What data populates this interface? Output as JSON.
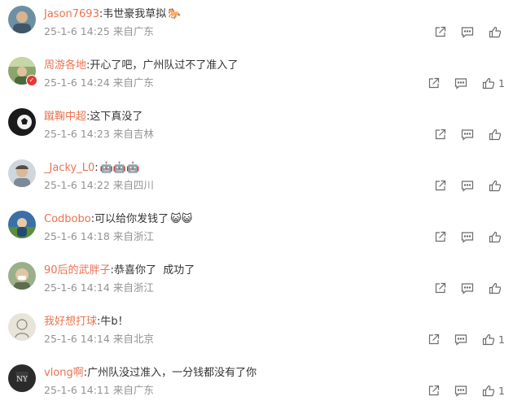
{
  "comments": [
    {
      "username": "Jason7693",
      "separator": ":",
      "text": "韦世豪我草拟",
      "emoji": "🐎",
      "time": "25-1-6 14:25",
      "location": "来自广东",
      "likes": "",
      "icons": {
        "share": "share-icon",
        "reply": "reply-icon",
        "like": "thumbs-up-icon"
      }
    },
    {
      "username": "周游各地",
      "separator": ":",
      "text": "开心了吧，广州队过不了准入了",
      "emoji": "",
      "time": "25-1-6 14:24",
      "location": "来自广东",
      "likes": "1",
      "icons": {
        "share": "share-icon",
        "reply": "reply-icon",
        "like": "thumbs-up-icon"
      }
    },
    {
      "username": "蹴鞠中超",
      "separator": ":",
      "text": "这下真没了",
      "emoji": "",
      "time": "25-1-6 14:23",
      "location": "来自吉林",
      "likes": "",
      "icons": {
        "share": "share-icon",
        "reply": "reply-icon",
        "like": "thumbs-up-icon"
      }
    },
    {
      "username": "_Jacky_L0",
      "separator": ":",
      "text": "",
      "emoji": "🤖🤖🤖",
      "time": "25-1-6 14:22",
      "location": "来自四川",
      "likes": "",
      "icons": {
        "share": "share-icon",
        "reply": "reply-icon",
        "like": "thumbs-up-icon"
      }
    },
    {
      "username": "Codbobo",
      "separator": ":",
      "text": "可以给你发钱了",
      "emoji": "😺😺",
      "time": "25-1-6 14:18",
      "location": "来自浙江",
      "likes": "",
      "icons": {
        "share": "share-icon",
        "reply": "reply-icon",
        "like": "thumbs-up-icon"
      }
    },
    {
      "username": "90后的武胖子",
      "separator": ":",
      "text": "恭喜你了  成功了",
      "emoji": "",
      "time": "25-1-6 14:14",
      "location": "来自浙江",
      "likes": "",
      "icons": {
        "share": "share-icon",
        "reply": "reply-icon",
        "like": "thumbs-up-icon"
      }
    },
    {
      "username": "我好想打球",
      "separator": ":",
      "text": "牛b！",
      "emoji": "",
      "time": "25-1-6 14:14",
      "location": "来自北京",
      "likes": "1",
      "icons": {
        "share": "share-icon",
        "reply": "reply-icon",
        "like": "thumbs-up-icon"
      }
    },
    {
      "username": "vlong啊",
      "separator": ":",
      "text": "广州队没过准入，一分钱都没有了你",
      "emoji": "",
      "time": "25-1-6 14:11",
      "location": "来自广东",
      "likes": "1",
      "icons": {
        "share": "share-icon",
        "reply": "reply-icon",
        "like": "thumbs-up-icon"
      }
    }
  ],
  "colors": {
    "username": "#eb7350",
    "meta": "#939393",
    "text": "#333333",
    "icon": "#6b6b6b"
  }
}
